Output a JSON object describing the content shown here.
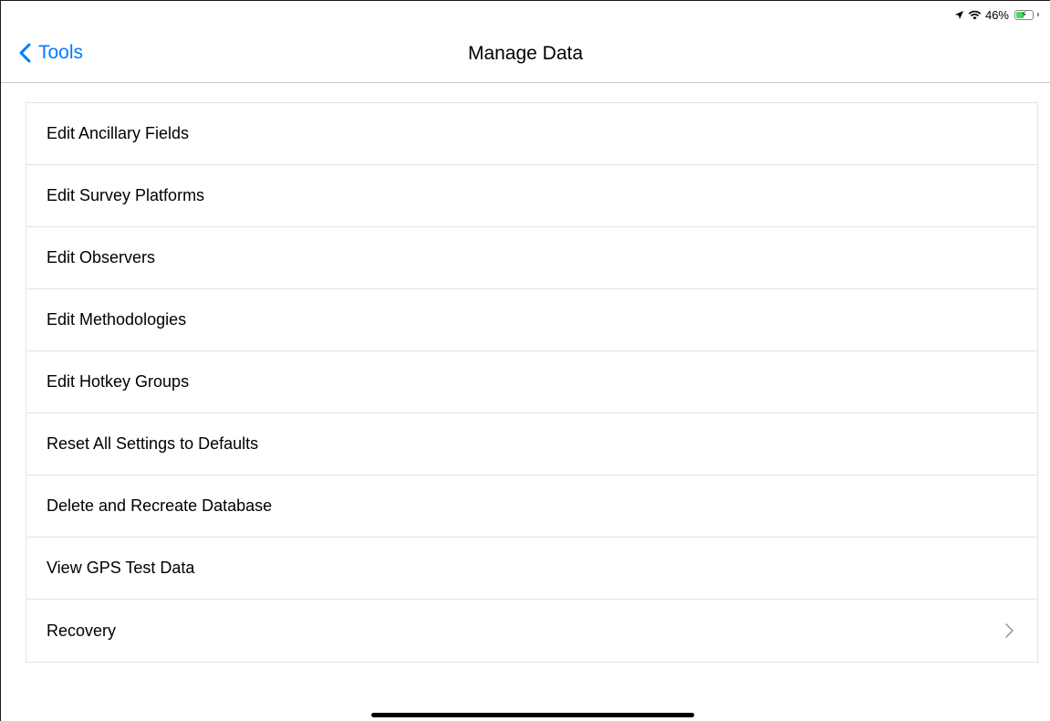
{
  "status_bar": {
    "battery_percent": "46%",
    "battery_level": 0.46,
    "charging": true,
    "icons": [
      "location-arrow-icon",
      "wifi-icon",
      "battery-charging-icon"
    ]
  },
  "nav": {
    "back_label": "Tools",
    "title": "Manage Data",
    "accent_color": "#007aff"
  },
  "list": {
    "items": [
      {
        "label": "Edit Ancillary Fields",
        "disclosure": false
      },
      {
        "label": "Edit Survey Platforms",
        "disclosure": false
      },
      {
        "label": "Edit Observers",
        "disclosure": false
      },
      {
        "label": "Edit Methodologies",
        "disclosure": false
      },
      {
        "label": "Edit Hotkey Groups",
        "disclosure": false
      },
      {
        "label": "Reset All Settings to Defaults",
        "disclosure": false
      },
      {
        "label": "Delete and Recreate Database",
        "disclosure": false
      },
      {
        "label": "View GPS Test Data",
        "disclosure": false
      },
      {
        "label": "Recovery",
        "disclosure": true
      }
    ]
  }
}
